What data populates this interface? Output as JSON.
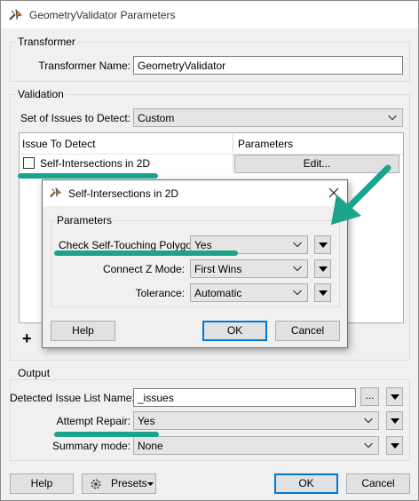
{
  "window": {
    "title": "GeometryValidator Parameters"
  },
  "transformer": {
    "group_label": "Transformer",
    "name_label": "Transformer Name:",
    "name_value": "GeometryValidator"
  },
  "validation": {
    "group_label": "Validation",
    "issues_label": "Set of Issues to Detect:",
    "issues_value": "Custom",
    "table": {
      "col_issue": "Issue To Detect",
      "col_params": "Parameters",
      "row_label": "Self-Intersections in 2D",
      "edit_label": "Edit..."
    },
    "add_label": "+"
  },
  "dialog": {
    "title": "Self-Intersections in 2D",
    "group_label": "Parameters",
    "check_label": "Check Self-Touching Polygon:",
    "check_value": "Yes",
    "zmode_label": "Connect Z Mode:",
    "zmode_value": "First Wins",
    "tolerance_label": "Tolerance:",
    "tolerance_value": "Automatic",
    "help_label": "Help",
    "ok_label": "OK",
    "cancel_label": "Cancel"
  },
  "output": {
    "group_label": "Output",
    "issue_list_label": "Detected Issue List Name:",
    "issue_list_value": "_issues",
    "ellipsis_label": "...",
    "repair_label": "Attempt Repair:",
    "repair_value": "Yes",
    "summary_label": "Summary mode:",
    "summary_value": "None"
  },
  "footer": {
    "help_label": "Help",
    "presets_label": "Presets",
    "ok_label": "OK",
    "cancel_label": "Cancel"
  },
  "annotation_color": "#1aa58a",
  "icons": [
    "fme-app-icon",
    "close-icon",
    "chevron-down-icon",
    "triangle-down-icon",
    "gear-icon",
    "checkbox-icon"
  ]
}
